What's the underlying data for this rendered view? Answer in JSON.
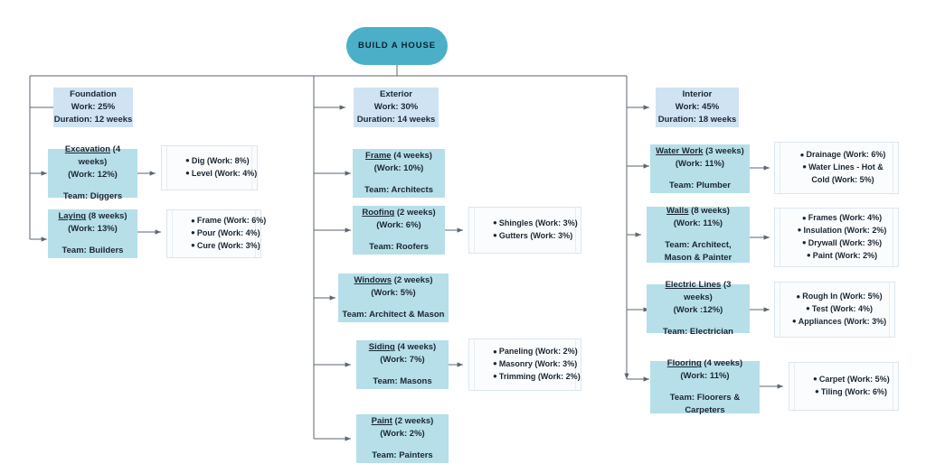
{
  "diagram": {
    "title": "Build A House Work Breakdown Structure",
    "colors": {
      "root_fill": "#4aafc7",
      "phase_fill": "#cfe3f3",
      "task_fill": "#b6dfe9",
      "leaf_fill": "#fbfcfd",
      "leaf_border": "#dbe6ee",
      "connector": "#5b6670",
      "text": "#1b2733"
    },
    "root": {
      "label": "BUILD A HOUSE"
    },
    "branches": [
      {
        "id": "foundation",
        "phase": {
          "name": "Foundation",
          "work": "Work: 25%",
          "duration": "Duration: 12 weeks"
        },
        "tasks": [
          {
            "name": "Excavation",
            "duration": "(4 weeks)",
            "work": "(Work: 12%)",
            "team": "Team: Diggers",
            "subtasks": [
              "Dig (Work: 8%)",
              "Level (Work: 4%)"
            ]
          },
          {
            "name": "Laying",
            "duration": "(8 weeks)",
            "work": "(Work: 13%)",
            "team": "Team: Builders",
            "subtasks": [
              "Frame (Work: 6%)",
              "Pour (Work: 4%)",
              "Cure (Work: 3%)"
            ]
          }
        ]
      },
      {
        "id": "exterior",
        "phase": {
          "name": "Exterior",
          "work": "Work: 30%",
          "duration": "Duration: 14 weeks"
        },
        "tasks": [
          {
            "name": "Frame",
            "duration": "(4 weeks)",
            "work": "(Work: 10%)",
            "team": "Team: Architects",
            "subtasks": []
          },
          {
            "name": "Roofing",
            "duration": "(2 weeks)",
            "work": "(Work: 6%)",
            "team": "Team: Roofers",
            "subtasks": [
              "Shingles (Work: 3%)",
              "Gutters (Work: 3%)"
            ]
          },
          {
            "name": "Windows",
            "duration": "(2 weeks)",
            "work": "(Work: 5%)",
            "team": "Team: Architect & Mason",
            "subtasks": []
          },
          {
            "name": "Siding",
            "duration": "(4 weeks)",
            "work": "(Work: 7%)",
            "team": "Team: Masons",
            "subtasks": [
              "Paneling (Work: 2%)",
              "Masonry (Work: 3%)",
              "Trimming (Work: 2%)"
            ]
          },
          {
            "name": "Paint",
            "duration": "(2 weeks)",
            "work": "(Work: 2%)",
            "team": "Team: Painters",
            "subtasks": []
          }
        ]
      },
      {
        "id": "interior",
        "phase": {
          "name": "Interior",
          "work": "Work: 45%",
          "duration": "Duration: 18 weeks"
        },
        "tasks": [
          {
            "name": "Water Work",
            "duration": "(3 weeks)",
            "work": "(Work: 11%)",
            "team": "Team: Plumber",
            "subtasks": [
              "Drainage (Work: 6%)",
              "Water Lines - Hot & Cold (Work: 5%)"
            ]
          },
          {
            "name": "Walls",
            "duration": "(8 weeks)",
            "work": "(Work: 11%)",
            "team": "Team: Architect, Mason & Painter",
            "subtasks": [
              "Frames (Work: 4%)",
              "Insulation (Work: 2%)",
              "Drywall (Work: 3%)",
              "Paint (Work: 2%)"
            ]
          },
          {
            "name": "Electric Lines",
            "duration": "(3 weeks)",
            "work": "(Work :12%)",
            "team": "Team: Electrician",
            "subtasks": [
              "Rough In (Work: 5%)",
              "Test (Work: 4%)",
              "Appliances (Work: 3%)"
            ]
          },
          {
            "name": "Flooring",
            "duration": "(4 weeks)",
            "work": "(Work: 11%)",
            "team": "Team: Floorers & Carpeters",
            "subtasks": [
              "Carpet (Work: 5%)",
              "Tiling (Work: 6%)"
            ]
          }
        ]
      }
    ]
  }
}
